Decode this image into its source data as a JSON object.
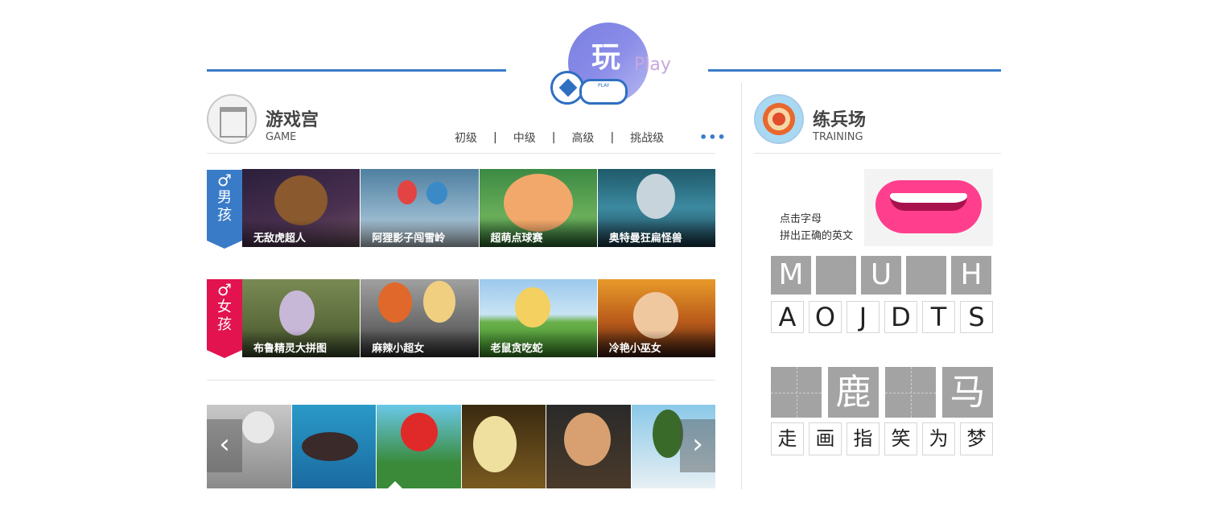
{
  "logo": {
    "cn": "玩",
    "en": "Play",
    "pad_text": "PLAY"
  },
  "game_section": {
    "title": "游戏宫",
    "subtitle": "GAME",
    "levels": [
      "初级",
      "中级",
      "高级",
      "挑战级"
    ],
    "more": "•••",
    "boy_label": {
      "symbol": "♂",
      "text1": "男",
      "text2": "孩"
    },
    "girl_label": {
      "symbol": "♂",
      "text1": "女",
      "text2": "孩"
    },
    "boy_games": [
      "无敌虎超人",
      "阿狸影子闯雪岭",
      "超萌点球赛",
      "奥特曼狂扁怪兽"
    ],
    "girl_games": [
      "布鲁精灵大拼图",
      "麻辣小超女",
      "老鼠贪吃蛇",
      "冷艳小巫女"
    ]
  },
  "training_section": {
    "title": "练兵场",
    "subtitle": "TRAINING",
    "prompt_line1": "点击字母",
    "prompt_line2": "拼出正确的英文",
    "target_letters": [
      "M",
      "",
      "U",
      "",
      "H"
    ],
    "letter_options": [
      "A",
      "O",
      "J",
      "D",
      "T",
      "S"
    ],
    "target_hanzi": [
      "",
      "鹿",
      "",
      "马"
    ],
    "hanzi_options": [
      "走",
      "画",
      "指",
      "笑",
      "为",
      "梦"
    ]
  },
  "carousel": {
    "prev": "‹",
    "next": "›"
  },
  "colors": {
    "accent": "#3a7bc8",
    "girl": "#e2134f",
    "tile_gray": "#a3a3a3"
  }
}
